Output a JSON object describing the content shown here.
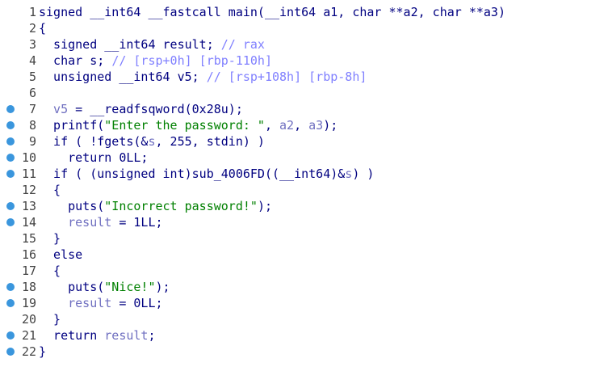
{
  "colors": {
    "background": "#ffffff",
    "code": "#000080",
    "string": "#008000",
    "variable": "#6f6fc0",
    "comment": "#8080ff",
    "line_number": "#444444",
    "breakpoint_dot": "#3a96dd"
  },
  "lines": [
    {
      "num": "1",
      "dot": false,
      "segs": [
        {
          "t": "signed __int64 __fastcall main(__int64 a1, char **a2, char **a3)",
          "c": "plain"
        }
      ]
    },
    {
      "num": "2",
      "dot": false,
      "segs": [
        {
          "t": "{",
          "c": "plain"
        }
      ]
    },
    {
      "num": "3",
      "dot": false,
      "segs": [
        {
          "t": "  signed __int64 result; ",
          "c": "plain"
        },
        {
          "t": "// rax",
          "c": "comment"
        }
      ]
    },
    {
      "num": "4",
      "dot": false,
      "segs": [
        {
          "t": "  char s; ",
          "c": "plain"
        },
        {
          "t": "// [rsp+0h] [rbp-110h]",
          "c": "comment"
        }
      ]
    },
    {
      "num": "5",
      "dot": false,
      "segs": [
        {
          "t": "  unsigned __int64 v5; ",
          "c": "plain"
        },
        {
          "t": "// [rsp+108h] [rbp-8h]",
          "c": "comment"
        }
      ]
    },
    {
      "num": "6",
      "dot": false,
      "segs": []
    },
    {
      "num": "7",
      "dot": true,
      "segs": [
        {
          "t": "  v5",
          "c": "var"
        },
        {
          "t": " = __readfsqword(0x28u);",
          "c": "plain"
        }
      ]
    },
    {
      "num": "8",
      "dot": true,
      "segs": [
        {
          "t": "  printf(",
          "c": "plain"
        },
        {
          "t": "\"Enter the password: \"",
          "c": "str"
        },
        {
          "t": ", ",
          "c": "plain"
        },
        {
          "t": "a2",
          "c": "var"
        },
        {
          "t": ", ",
          "c": "plain"
        },
        {
          "t": "a3",
          "c": "var"
        },
        {
          "t": ");",
          "c": "plain"
        }
      ]
    },
    {
      "num": "9",
      "dot": true,
      "segs": [
        {
          "t": "  if ( !fgets(&",
          "c": "plain"
        },
        {
          "t": "s",
          "c": "var"
        },
        {
          "t": ", 255, stdin) )",
          "c": "plain"
        }
      ]
    },
    {
      "num": "10",
      "dot": true,
      "segs": [
        {
          "t": "    return 0LL;",
          "c": "plain"
        }
      ]
    },
    {
      "num": "11",
      "dot": true,
      "segs": [
        {
          "t": "  if ( (unsigned int)sub_4006FD((__int64)&",
          "c": "plain"
        },
        {
          "t": "s",
          "c": "var"
        },
        {
          "t": ") )",
          "c": "plain"
        }
      ]
    },
    {
      "num": "12",
      "dot": false,
      "segs": [
        {
          "t": "  {",
          "c": "plain"
        }
      ]
    },
    {
      "num": "13",
      "dot": true,
      "segs": [
        {
          "t": "    puts(",
          "c": "plain"
        },
        {
          "t": "\"Incorrect password!\"",
          "c": "str"
        },
        {
          "t": ");",
          "c": "plain"
        }
      ]
    },
    {
      "num": "14",
      "dot": true,
      "segs": [
        {
          "t": "    result",
          "c": "var"
        },
        {
          "t": " = 1LL;",
          "c": "plain"
        }
      ]
    },
    {
      "num": "15",
      "dot": false,
      "segs": [
        {
          "t": "  }",
          "c": "plain"
        }
      ]
    },
    {
      "num": "16",
      "dot": false,
      "segs": [
        {
          "t": "  else",
          "c": "plain"
        }
      ]
    },
    {
      "num": "17",
      "dot": false,
      "segs": [
        {
          "t": "  {",
          "c": "plain"
        }
      ]
    },
    {
      "num": "18",
      "dot": true,
      "segs": [
        {
          "t": "    puts(",
          "c": "plain"
        },
        {
          "t": "\"Nice!\"",
          "c": "str"
        },
        {
          "t": ");",
          "c": "plain"
        }
      ]
    },
    {
      "num": "19",
      "dot": true,
      "segs": [
        {
          "t": "    result",
          "c": "var"
        },
        {
          "t": " = 0LL;",
          "c": "plain"
        }
      ]
    },
    {
      "num": "20",
      "dot": false,
      "segs": [
        {
          "t": "  }",
          "c": "plain"
        }
      ]
    },
    {
      "num": "21",
      "dot": true,
      "segs": [
        {
          "t": "  return ",
          "c": "plain"
        },
        {
          "t": "result",
          "c": "var"
        },
        {
          "t": ";",
          "c": "plain"
        }
      ]
    },
    {
      "num": "22",
      "dot": true,
      "segs": [
        {
          "t": "}",
          "c": "plain"
        }
      ]
    }
  ]
}
